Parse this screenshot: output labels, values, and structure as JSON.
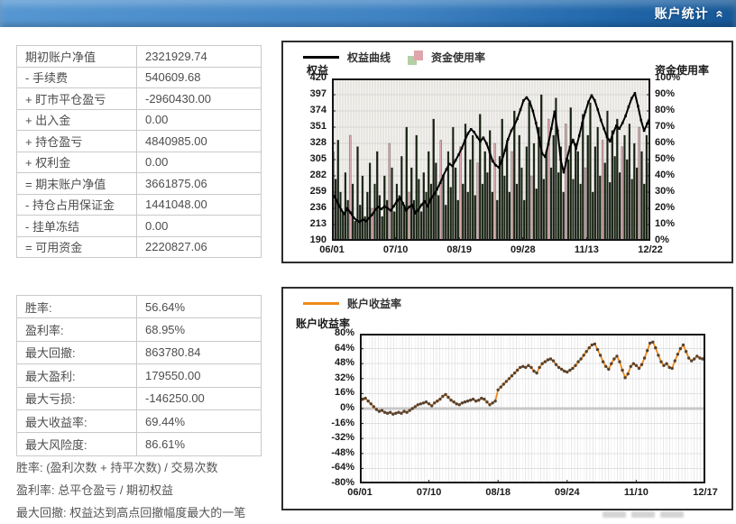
{
  "header": {
    "title": "账户统计",
    "collapse_icon": "«"
  },
  "summary_table": {
    "rows": [
      {
        "label": "期初账户净值",
        "value": "2321929.74"
      },
      {
        "label": "- 手续费",
        "value": "540609.68"
      },
      {
        "label": "+ 盯市平仓盈亏",
        "value": "-2960430.00"
      },
      {
        "label": "+ 出入金",
        "value": "0.00"
      },
      {
        "label": "+ 持仓盈亏",
        "value": "4840985.00"
      },
      {
        "label": "+ 权利金",
        "value": "0.00"
      },
      {
        "label": "= 期末账户净值",
        "value": "3661875.06"
      },
      {
        "label": "- 持仓占用保证金",
        "value": "1441048.00"
      },
      {
        "label": "- 挂单冻结",
        "value": "0.00"
      },
      {
        "label": "= 可用资金",
        "value": "2220827.06"
      }
    ]
  },
  "stats_table": {
    "rows": [
      {
        "label": "胜率:",
        "value": "56.64%"
      },
      {
        "label": "盈利率:",
        "value": "68.95%"
      },
      {
        "label": "最大回撤:",
        "value": "863780.84"
      },
      {
        "label": "最大盈利:",
        "value": "179550.00"
      },
      {
        "label": "最大亏损:",
        "value": "-146250.00"
      },
      {
        "label": "最大收益率:",
        "value": "69.44%"
      },
      {
        "label": "最大风险度:",
        "value": "86.61%"
      }
    ]
  },
  "footnotes": [
    "胜率: (盈利次数 + 持平次数) / 交易次数",
    "盈利率: 总平仓盈亏 / 期初权益",
    "最大回撤: 权益达到高点回撤幅度最大的一笔"
  ],
  "chart_data": [
    {
      "type": "line+bar",
      "legend": [
        {
          "label": "权益曲线",
          "type": "line",
          "color": "#000000"
        },
        {
          "label": "资金使用率",
          "type": "bar",
          "colors": [
            "#b3cfa6",
            "#dfa5ab"
          ]
        }
      ],
      "left_axis": {
        "label": "权益",
        "ticks": [
          "420",
          "397",
          "374",
          "351",
          "328",
          "305",
          "282",
          "259",
          "236",
          "213",
          "190"
        ],
        "min": 190,
        "max": 420
      },
      "right_axis": {
        "label": "资金使用率",
        "ticks": [
          "100%",
          "90%",
          "80%",
          "70%",
          "60%",
          "50%",
          "40%",
          "30%",
          "20%",
          "10%",
          "0%"
        ],
        "min": 0,
        "max": 100
      },
      "x_ticks": [
        "06/01",
        "07/10",
        "08/19",
        "09/28",
        "11/13",
        "12/22"
      ],
      "grid": true,
      "line_series": {
        "name": "权益曲线",
        "color": "#000000",
        "values": [
          258,
          252,
          242,
          234,
          228,
          236,
          230,
          223,
          219,
          217,
          220,
          218,
          222,
          227,
          234,
          238,
          235,
          239,
          236,
          233,
          239,
          246,
          251,
          243,
          233,
          238,
          241,
          229,
          234,
          241,
          246,
          239,
          249,
          256,
          263,
          272,
          282,
          291,
          299,
          296,
          304,
          312,
          321,
          332,
          342,
          348,
          344,
          337,
          331,
          336,
          328,
          316,
          303,
          297,
          294,
          304,
          318,
          334,
          346,
          353,
          363,
          376,
          389,
          393,
          387,
          374,
          357,
          336,
          314,
          309,
          327,
          349,
          373,
          346,
          305,
          287,
          306,
          323,
          333,
          321,
          339,
          357,
          373,
          387,
          396,
          389,
          376,
          361,
          349,
          337,
          331,
          343,
          353,
          349,
          357,
          367,
          380,
          392,
          399,
          381,
          361,
          346,
          356,
          367
        ]
      },
      "bar_series": {
        "name": "资金使用率",
        "unit": "%",
        "values": [
          55,
          38,
          62,
          30,
          18,
          42,
          25,
          65,
          35,
          12,
          58,
          22,
          40,
          15,
          30,
          48,
          20,
          35,
          55,
          28,
          15,
          40,
          25,
          60,
          45,
          18,
          35,
          28,
          52,
          22,
          70,
          30,
          45,
          25,
          65,
          38,
          18,
          42,
          30,
          55,
          35,
          75,
          48,
          28,
          62,
          40,
          22,
          55,
          33,
          70,
          45,
          25,
          58,
          35,
          72,
          30,
          50,
          65,
          28,
          48,
          78,
          35,
          55,
          42,
          68,
          30,
          60,
          25,
          52,
          75,
          40,
          62,
          30,
          55,
          80,
          35,
          65,
          45,
          25,
          58,
          85,
          40,
          60,
          32,
          70,
          90,
          38,
          55,
          75,
          45,
          65,
          88,
          42,
          58,
          30,
          72,
          50,
          82,
          38,
          60,
          55,
          35,
          78,
          45,
          65,
          85,
          30,
          58,
          70,
          40,
          62,
          48,
          80,
          36,
          68,
          52,
          75,
          42,
          58,
          65,
          50,
          72,
          38,
          60,
          45,
          70,
          55,
          35,
          65,
          48
        ],
        "red_indices": [
          7,
          16,
          23,
          31,
          44,
          52,
          59,
          66,
          73,
          81,
          88,
          95,
          103,
          110,
          118,
          125
        ]
      }
    },
    {
      "type": "line",
      "legend": [
        {
          "label": "账户收益率",
          "type": "line",
          "color": "#ef8a1a"
        }
      ],
      "y_axis": {
        "label": "账户收益率",
        "ticks": [
          "80%",
          "64%",
          "48%",
          "32%",
          "16%",
          "0%",
          "-16%",
          "-32%",
          "-48%",
          "-64%",
          "-80%"
        ],
        "min": -80,
        "max": 80
      },
      "x_ticks": [
        "06/01",
        "07/10",
        "08/18",
        "09/24",
        "11/10",
        "12/17"
      ],
      "grid": true,
      "line_series": {
        "name": "账户收益率",
        "color": "#ef8a1a",
        "marker_color": "#58422e",
        "unit": "%",
        "values": [
          7,
          10,
          11,
          8,
          5,
          2,
          -1,
          -3,
          -2,
          -4,
          -5,
          -4,
          -6,
          -5,
          -4,
          -5,
          -3,
          -4,
          -2,
          0,
          2,
          4,
          5,
          6,
          7,
          5,
          3,
          6,
          8,
          10,
          13,
          15,
          12,
          9,
          7,
          5,
          4,
          6,
          7,
          8,
          9,
          10,
          8,
          9,
          11,
          10,
          7,
          4,
          6,
          8,
          20,
          23,
          26,
          29,
          32,
          35,
          38,
          41,
          44,
          45,
          44,
          46,
          44,
          40,
          38,
          44,
          48,
          50,
          52,
          53,
          51,
          47,
          44,
          42,
          40,
          39,
          41,
          43,
          46,
          50,
          53,
          57,
          61,
          65,
          68,
          69,
          63,
          57,
          50,
          45,
          42,
          48,
          53,
          56,
          50,
          41,
          33,
          37,
          45,
          48,
          46,
          43,
          47,
          54,
          62,
          70,
          71,
          65,
          57,
          50,
          46,
          48,
          44,
          43,
          51,
          58,
          64,
          68,
          61,
          54,
          51,
          53,
          56,
          54,
          53,
          57
        ]
      }
    }
  ]
}
